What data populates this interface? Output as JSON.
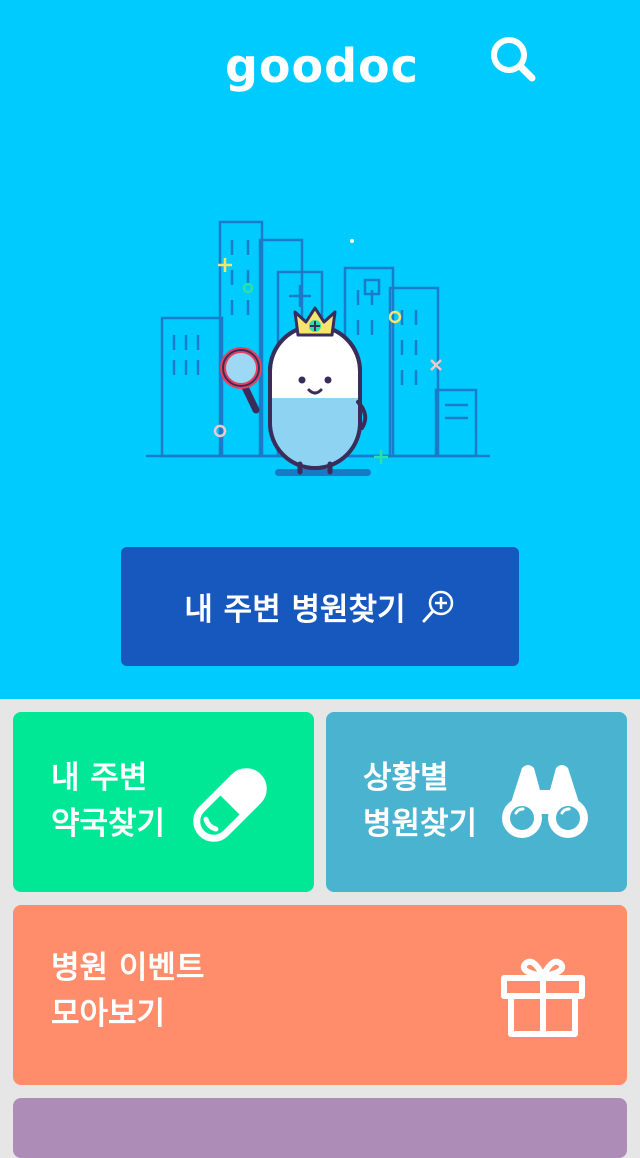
{
  "header": {
    "logo_text": "goodoc",
    "search_icon": "search-icon"
  },
  "hero": {
    "illustration": "pill-mascot-city-illustration",
    "cta_label": "내 주변 병원찾기",
    "cta_icon": "magnifier-plus-icon"
  },
  "tiles": [
    {
      "line1": "내 주변",
      "line2": "약국찾기",
      "icon": "pill-icon",
      "color": "#00e896"
    },
    {
      "line1": "상황별",
      "line2": "병원찾기",
      "icon": "binoculars-icon",
      "color": "#4ab3d0"
    },
    {
      "line1": "병원 이벤트",
      "line2": "모아보기",
      "icon": "gift-icon",
      "color": "#ff8c6a"
    },
    {
      "color": "#ae8cb8"
    }
  ],
  "colors": {
    "hero_bg": "#00cbff",
    "cta_bg": "#1758bf",
    "page_bg": "#e6e6e6"
  }
}
